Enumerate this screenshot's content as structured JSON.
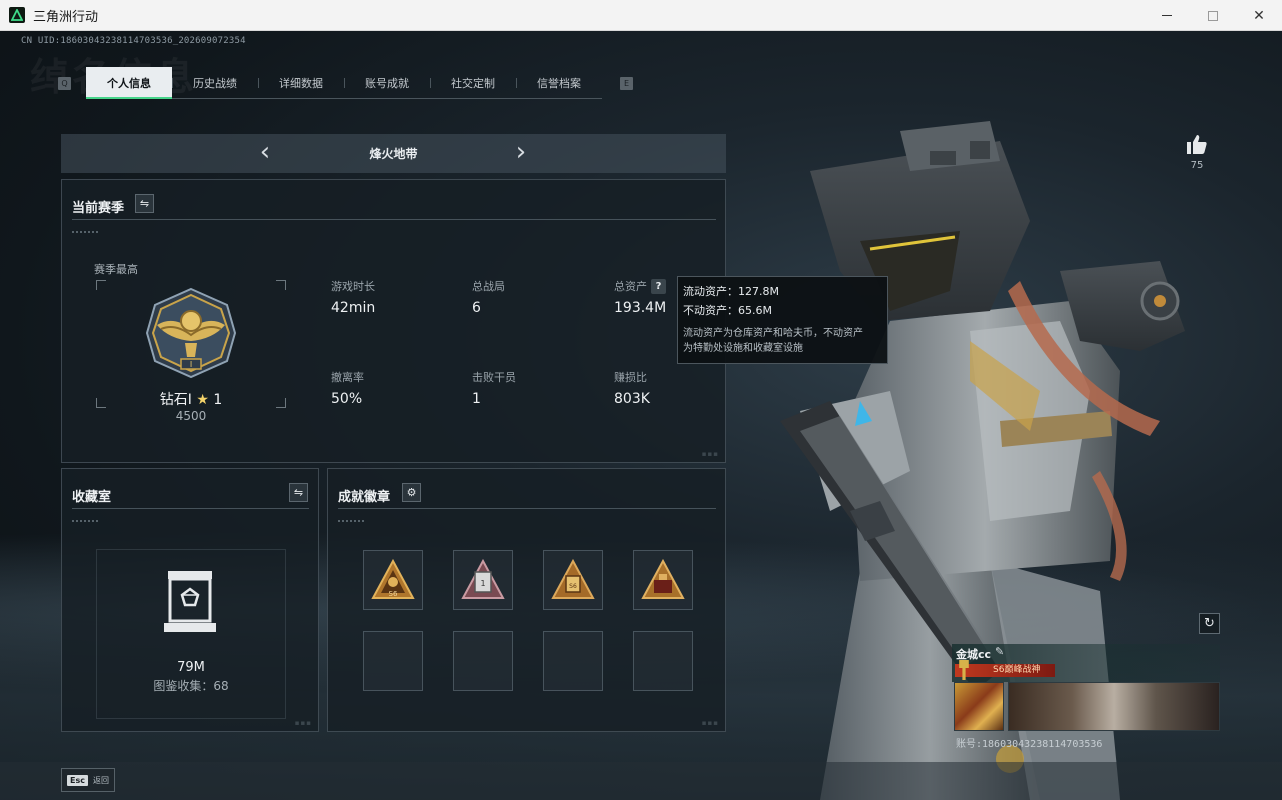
{
  "window": {
    "title": "三角洲行动"
  },
  "header": {
    "uid": "CN UID:18603043238114703536_202609072354",
    "watermark": "绰名信息"
  },
  "tabs": [
    {
      "label": "个人信息",
      "active": true
    },
    {
      "label": "历史战绩",
      "active": false
    },
    {
      "label": "详细数据",
      "active": false
    },
    {
      "label": "账号成就",
      "active": false
    },
    {
      "label": "社交定制",
      "active": false
    },
    {
      "label": "信誉档案",
      "active": false
    }
  ],
  "tab_keys": {
    "left": "Q",
    "right": "E"
  },
  "season_selector": {
    "name": "烽火地带",
    "prev_icon": "chevron-left-icon",
    "next_icon": "chevron-right-icon"
  },
  "current_season": {
    "title": "当前赛季",
    "best_label": "赛季最高",
    "rank": {
      "name": "钻石I",
      "star": "★",
      "stars": "1",
      "points": "4500"
    },
    "stats": [
      {
        "label": "游戏时长",
        "value": "42min"
      },
      {
        "label": "总战局",
        "value": "6"
      },
      {
        "label": "总资产",
        "value": "193.4M",
        "has_help": true
      },
      {
        "label": "撤离率",
        "value": "50%"
      },
      {
        "label": "击败干员",
        "value": "1"
      },
      {
        "label": "赚损比",
        "value": "803K"
      }
    ]
  },
  "tooltip": {
    "liquid": "流动资产：127.8M",
    "fixed": "不动资产：65.6M",
    "desc_line1": "流动资产为仓库资产和哈夫币，不动资产",
    "desc_line2": "为特勤处设施和收藏室设施"
  },
  "vault": {
    "title": "收藏室",
    "value": "79M",
    "collection": "图鉴收集：68"
  },
  "achievements": {
    "title": "成就徽章",
    "badges": [
      {
        "icon": "s6-badge-icon",
        "filled": true
      },
      {
        "icon": "s1-badge-icon",
        "filled": true
      },
      {
        "icon": "s6-triangle-badge-icon",
        "filled": true
      },
      {
        "icon": "crate-badge-icon",
        "filled": true
      },
      {
        "icon": "empty-slot",
        "filled": false
      },
      {
        "icon": "empty-slot",
        "filled": false
      },
      {
        "icon": "empty-slot",
        "filled": false
      },
      {
        "icon": "empty-slot",
        "filled": false
      }
    ]
  },
  "likes": {
    "count": "75"
  },
  "player_card": {
    "name": "金城cc",
    "title": "S6巅峰战神",
    "uid": "账号:18603043238114703536"
  },
  "bottom": {
    "esc_key": "Esc",
    "esc_label": "返回"
  },
  "colors": {
    "accent": "#46d48a",
    "tab_active_bg": "#e9edf0",
    "title_red": "#c0391f"
  }
}
